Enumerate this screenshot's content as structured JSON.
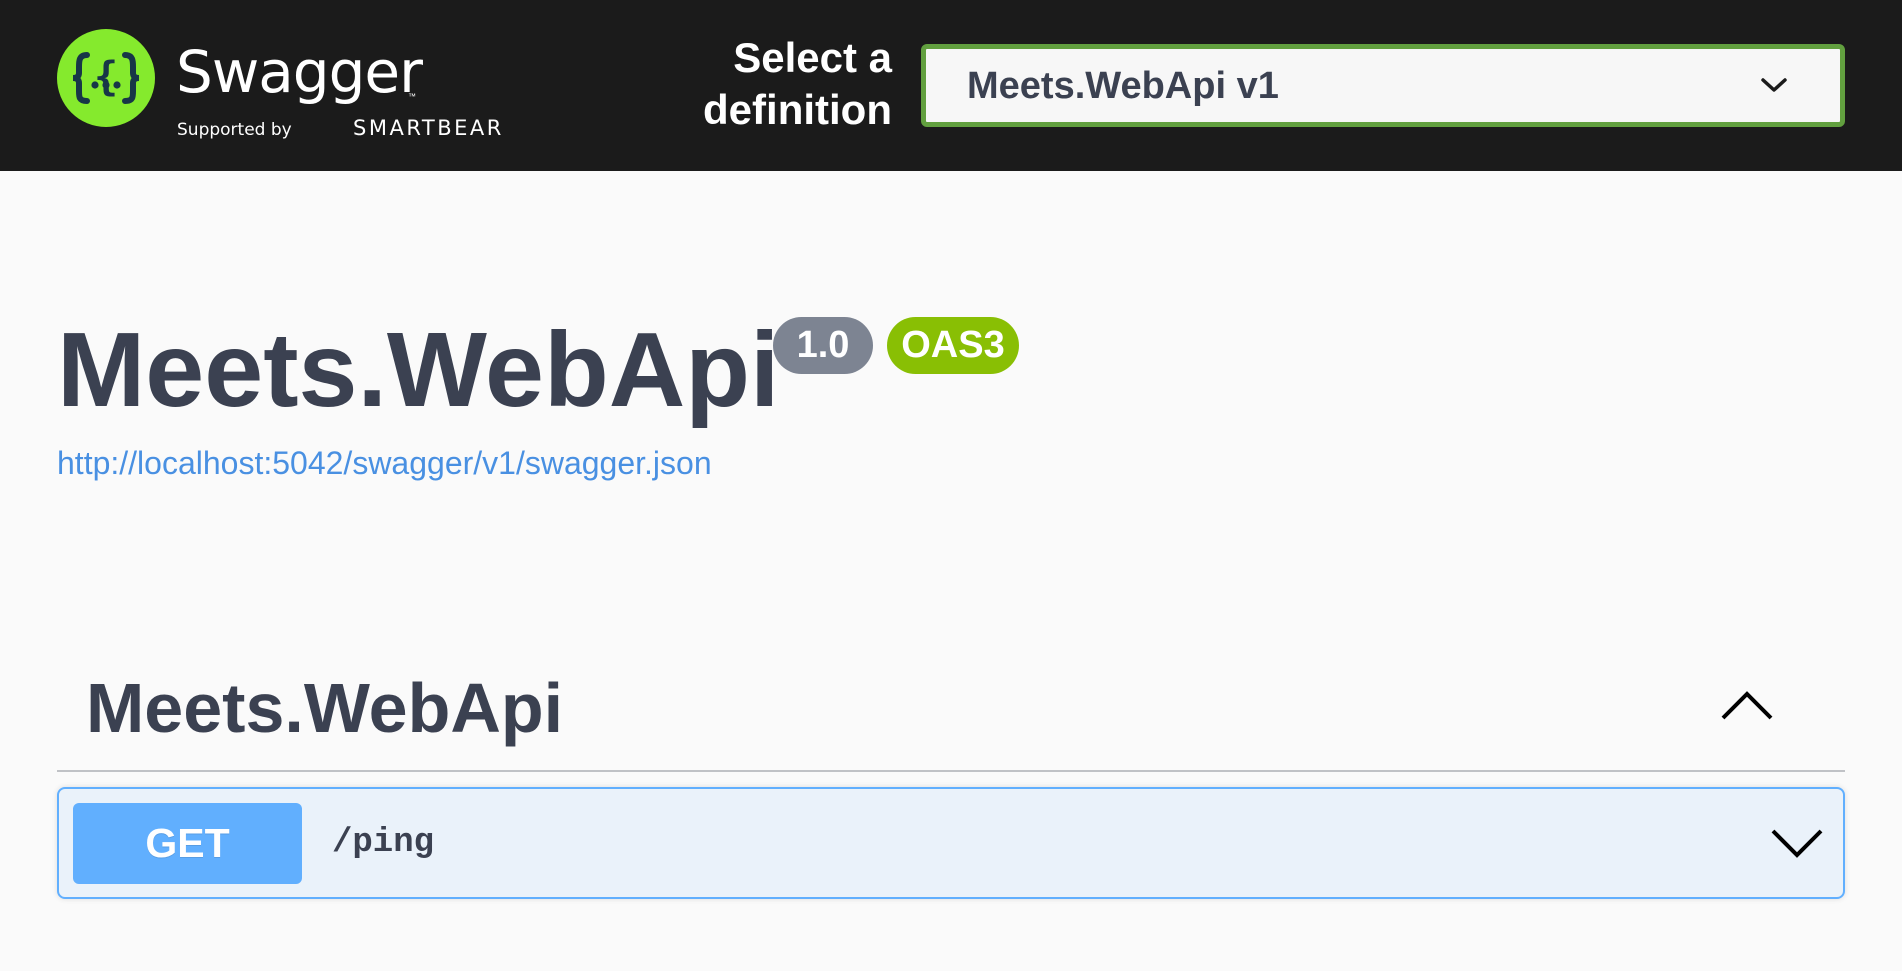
{
  "topbar": {
    "logo": {
      "wordmark": "Swagger",
      "trademark": "™",
      "supported_by": "Supported by",
      "company": "SMARTBEAR"
    },
    "select_label": "Select a definition",
    "definition_selected": "Meets.WebApi v1"
  },
  "info": {
    "title": "Meets.WebApi",
    "version": "1.0",
    "oas_badge": "OAS3",
    "spec_url": "http://localhost:5042/swagger/v1/swagger.json"
  },
  "tags": [
    {
      "name": "Meets.WebApi",
      "expanded": true,
      "operations": [
        {
          "method": "GET",
          "path": "/ping",
          "expanded": false
        }
      ]
    }
  ],
  "colors": {
    "topbar_bg": "#1b1b1b",
    "logo_green": "#85ea2d",
    "select_border": "#62a03f",
    "get_blue": "#61affe",
    "version_badge": "#7d8492",
    "oas_badge": "#89bf04",
    "link": "#4990e2",
    "text": "#3b4151"
  }
}
